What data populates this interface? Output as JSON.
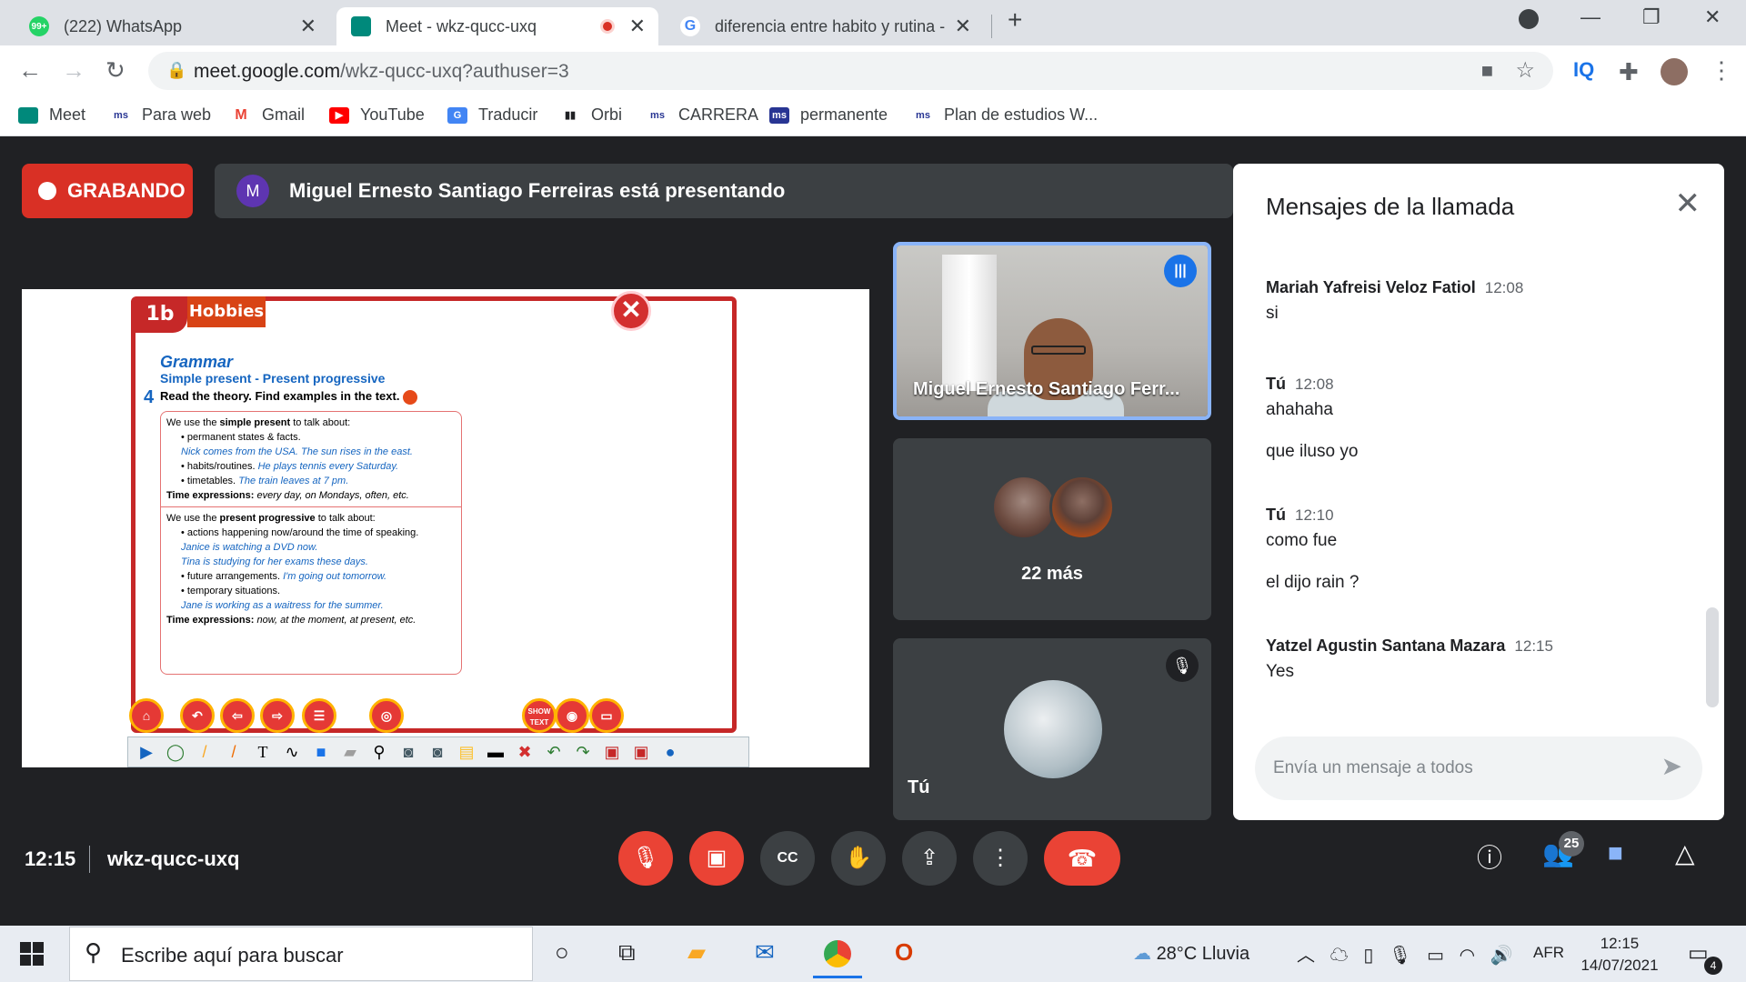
{
  "browser": {
    "tabs": [
      {
        "title": "(222) WhatsApp",
        "badge": "99+"
      },
      {
        "title": "Meet - wkz-qucc-uxq"
      },
      {
        "title": "diferencia entre habito y rutina -"
      }
    ],
    "url_host": "meet.google.com",
    "url_path": "/wkz-qucc-uxq?authuser=3",
    "bookmarks": [
      "Meet",
      "Para web",
      "Gmail",
      "YouTube",
      "Traducir",
      "Orbi",
      "CARRERA",
      "permanente",
      "Plan de estudios W..."
    ]
  },
  "meet": {
    "recording_label": "GRABANDO",
    "presenter_initial": "M",
    "presenting_text": "Miguel Ernesto Santiago Ferreiras está presentando",
    "time": "12:15",
    "meeting_code": "wkz-qucc-uxq",
    "participants_count": "25",
    "colors": {
      "recording": "#d93025",
      "end_call": "#ea4335",
      "speaking_border": "#8ab4f8"
    }
  },
  "slide": {
    "unit": "1b",
    "unit_title": "Hobbies",
    "section": "Grammar",
    "subtitle": "Simple present - Present progressive",
    "exercise_number": "4",
    "instruction": "Read the theory. Find examples in the text.",
    "theory": {
      "sp_intro_a": "We use the ",
      "sp_intro_b": "simple present",
      "sp_intro_c": " to talk about:",
      "sp1": "permanent states & facts.",
      "sp1_ex": "Nick comes from the USA. The sun rises in the east.",
      "sp2": "habits/routines.",
      "sp2_ex": "He plays tennis every Saturday.",
      "sp3": "timetables.",
      "sp3_ex": "The train leaves at 7 pm.",
      "sp_time_label": "Time expressions:",
      "sp_time": "every day, on Mondays, often, etc.",
      "pp_intro_a": "We use the ",
      "pp_intro_b": "present progressive",
      "pp_intro_c": " to talk about:",
      "pp1": "actions happening now/around the time of speaking.",
      "pp1_ex1": "Janice is watching a DVD now.",
      "pp1_ex2": "Tina is studying for her exams these days.",
      "pp2": "future arrangements.",
      "pp2_ex": "I'm going out tomorrow.",
      "pp3": "temporary situations.",
      "pp3_ex": "Jane is working as a waitress for the summer.",
      "pp_time_label": "Time expressions:",
      "pp_time": "now, at the moment, at present, etc."
    },
    "show_text_label": "SHOW TEXT"
  },
  "tiles": {
    "speaker_name": "Miguel Ernesto Santiago Ferr...",
    "more_label": "22 más",
    "self_label": "Tú"
  },
  "chat": {
    "title": "Mensajes de la llamada",
    "messages": [
      {
        "sender": "Mariah Yafreisi Veloz Fatiol",
        "time": "12:08",
        "lines": [
          "si"
        ]
      },
      {
        "sender": "Tú",
        "time": "12:08",
        "lines": [
          "ahahaha",
          "que iluso yo"
        ]
      },
      {
        "sender": "Tú",
        "time": "12:10",
        "lines": [
          "como fue",
          "el dijo rain ?"
        ]
      },
      {
        "sender": "Yatzel Agustin Santana Mazara",
        "time": "12:15",
        "lines": [
          "Yes"
        ]
      }
    ],
    "input_placeholder": "Envía un mensaje a todos"
  },
  "taskbar": {
    "search_placeholder": "Escribe aquí para buscar",
    "weather": "28°C  Lluvia",
    "language": "AFR",
    "time": "12:15",
    "date": "14/07/2021",
    "notifications": "4"
  }
}
